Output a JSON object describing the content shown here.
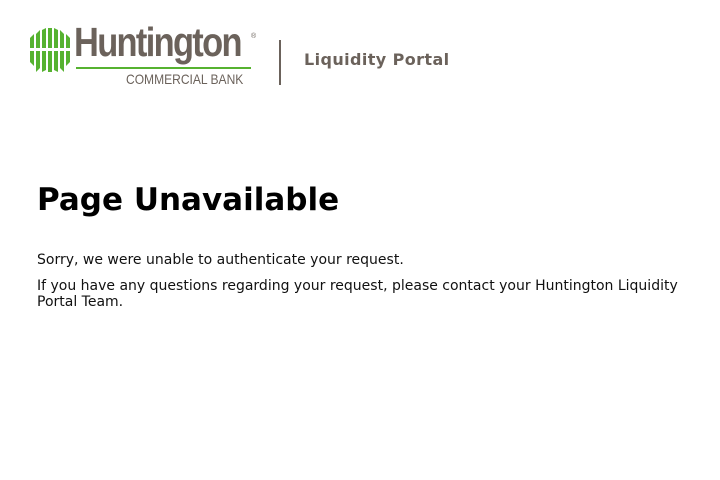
{
  "header": {
    "logo": {
      "name": "Huntington",
      "subtitle": "COMMERCIAL BANK",
      "registered_mark": "®",
      "colors": {
        "brand_green": "#56b230",
        "brand_gray": "#6b625b"
      }
    },
    "portal_title": "Liquidity Portal"
  },
  "main": {
    "heading": "Page Unavailable",
    "message_1": "Sorry, we were unable to authenticate your request.",
    "message_2": "If you have any questions regarding your request, please contact your Huntington Liquidity Portal Team."
  }
}
